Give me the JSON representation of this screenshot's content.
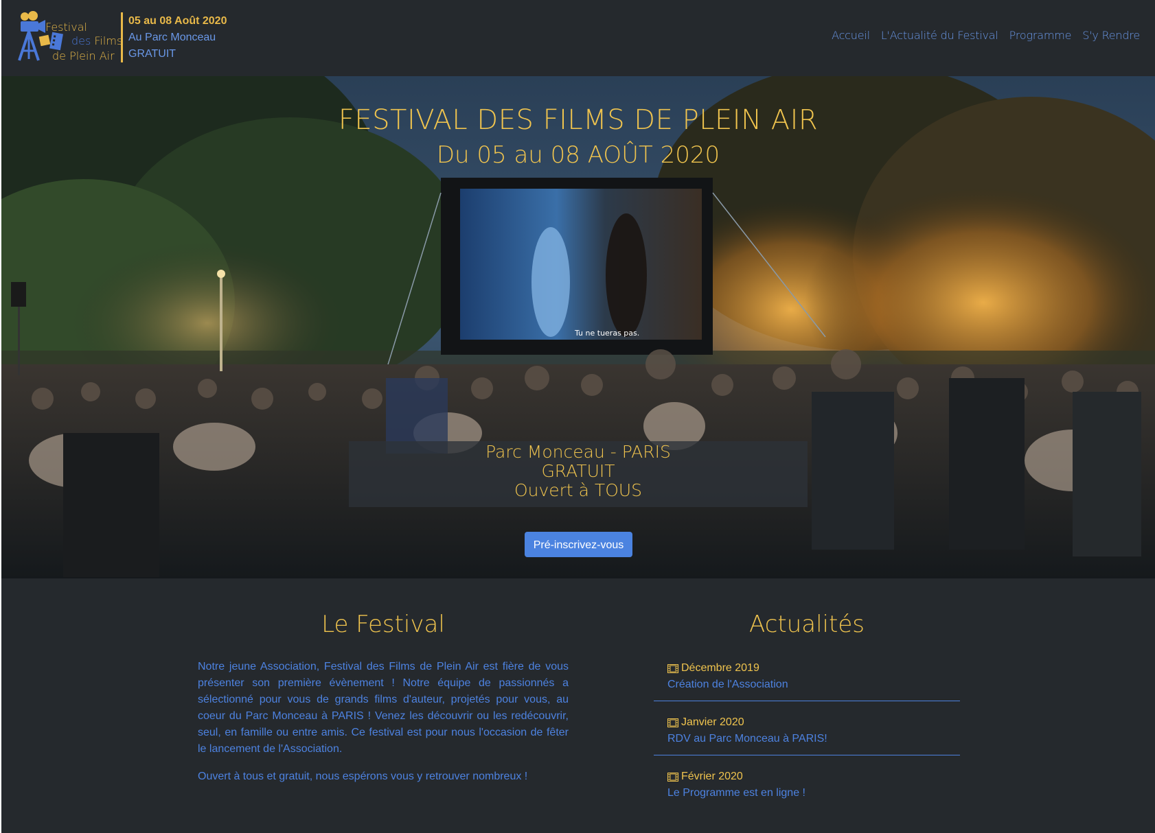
{
  "brand": {
    "logo_line1": "Festival",
    "logo_line2": "des Films",
    "logo_line3": "de Plein Air",
    "date": "05 au 08 Août 2020",
    "place": "Au Parc Monceau",
    "price": "GRATUIT"
  },
  "nav": {
    "items": [
      {
        "label": "Accueil"
      },
      {
        "label": "L'Actualité du Festival"
      },
      {
        "label": "Programme"
      },
      {
        "label": "S'y Rendre"
      }
    ]
  },
  "hero": {
    "title": "FESTIVAL DES FILMS DE PLEIN AIR",
    "subtitle": "Du 05 au 08 AOÛT 2020",
    "box_line1": "Parc Monceau - PARIS",
    "box_line2": "GRATUIT",
    "box_line3": "Ouvert à TOUS",
    "cta_label": "Pré-inscrivez-vous",
    "screen_subtitle": "Tu ne tueras pas."
  },
  "festival": {
    "title": "Le Festival",
    "paragraph1": "Notre jeune Association, Festival des Films de Plein Air est fière de vous présenter son première évènement ! Notre équipe de passionnés a sélectionné pour vous de grands films d'auteur, projetés pour vous, au coeur du Parc Monceau à PARIS ! Venez les découvrir ou les redécouvrir, seul, en famille ou entre amis. Ce festival est pour nous l'occasion de fêter le lancement de l'Association.",
    "paragraph2": "Ouvert à tous et gratuit, nous espérons vous y retrouver nombreux !"
  },
  "news": {
    "title": "Actualités",
    "items": [
      {
        "date": "Décembre 2019",
        "text": "Création de l'Association",
        "icon": "film-icon"
      },
      {
        "date": "Janvier 2020",
        "text": "RDV au Parc Monceau à PARIS!",
        "icon": "film-icon"
      },
      {
        "date": "Février 2020",
        "text": "Le Programme est en ligne !",
        "icon": "film-icon"
      }
    ]
  },
  "colors": {
    "background": "#25292d",
    "accent_gold": "#f0c44e",
    "accent_blue": "#4d82e0",
    "button": "#4b83e0"
  }
}
